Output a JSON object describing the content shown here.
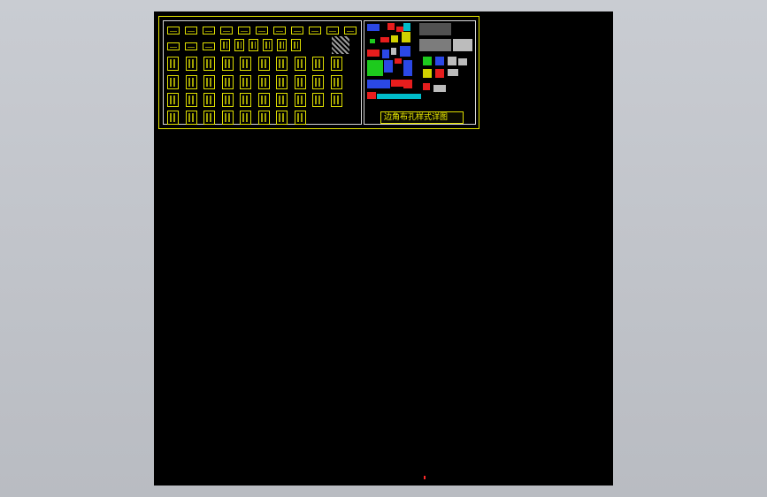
{
  "drawing": {
    "title_block_text": "边角布孔样式详图",
    "layout_colors": {
      "background": "#c0c3c9",
      "model_space": "#000000",
      "linework": "#e8e800",
      "frame": "#d8d8d8",
      "accent_red": "#ff2020",
      "accent_cyan": "#00d0e0",
      "accent_green": "#20e020",
      "accent_blue": "#3050ff"
    }
  }
}
